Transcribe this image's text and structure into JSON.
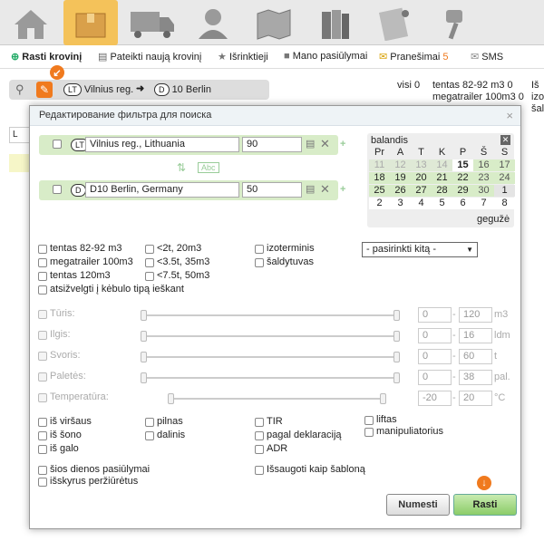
{
  "topnav": [
    "home-tab",
    "cargo-tab",
    "truck-tab",
    "person-tab",
    "map-tab",
    "books-tab",
    "paper-tab",
    "pin-tab"
  ],
  "subnav": {
    "find_cargo": "Rasti krovinį",
    "post_cargo": "Pateikti naują krovinį",
    "favorites": "Išrinktieji",
    "my_offers": "Mano pasiūlymai",
    "notifications": "Pranešimai",
    "notifications_count": "5",
    "sms": "SMS"
  },
  "route": {
    "from_code": "LT",
    "from": "Vilnius reg.",
    "to_code": "D",
    "to": "10 Berlin"
  },
  "bg_info": {
    "all": "visi 0",
    "line1": "tentas 82-92 m3 0",
    "line2": "megatrailer 100m3 0",
    "cut1": "Iš",
    "cut2": "izo",
    "cut3": "šal"
  },
  "bg_row": {
    "country": "L"
  },
  "dialog": {
    "title": "Редактирование фильтра для поиска",
    "close": "×",
    "from": {
      "country": "LT",
      "place": "Vilnius reg.,  Lithuania",
      "radius": "90"
    },
    "to": {
      "country": "D",
      "place": "D10 Berlin,  Germany",
      "radius": "50"
    },
    "swap_text": "Abc",
    "calendar": {
      "month": "balandis",
      "next_month": "gegužė",
      "weekdays": [
        "Pr",
        "A",
        "T",
        "K",
        "P",
        "Š",
        "S"
      ],
      "weeks": [
        [
          "11",
          "12",
          "13",
          "14",
          "15",
          "16",
          "17"
        ],
        [
          "18",
          "19",
          "20",
          "21",
          "22",
          "23",
          "24"
        ],
        [
          "25",
          "26",
          "27",
          "28",
          "29",
          "30",
          "1"
        ],
        [
          "2",
          "3",
          "4",
          "5",
          "6",
          "7",
          "8"
        ]
      ]
    },
    "body_types": [
      "tentas 82-92 m3",
      "megatrailer 100m3",
      "tentas 120m3",
      "<2t, 20m3",
      "<3.5t, 35m3",
      "<7.5t, 50m3",
      "izoterminis",
      "šaldytuvas"
    ],
    "body_type_select": "- pasirinkti kitą -",
    "consider_body": "atsižvelgti į kėbulo tipą ieškant",
    "ranges": [
      {
        "label": "Tūris:",
        "min": "0",
        "max": "120",
        "unit": "m3"
      },
      {
        "label": "Ilgis:",
        "min": "0",
        "max": "16",
        "unit": "ldm"
      },
      {
        "label": "Svoris:",
        "min": "0",
        "max": "60",
        "unit": "t"
      },
      {
        "label": "Paletės:",
        "min": "0",
        "max": "38",
        "unit": "pal."
      },
      {
        "label": "Temperatūra:",
        "min": "-20",
        "max": "20",
        "unit": "°C"
      }
    ],
    "loading": [
      "iš viršaus",
      "iš šono",
      "iš galo"
    ],
    "load_type": [
      "pilnas",
      "dalinis"
    ],
    "docs": [
      "TIR",
      "pagal deklaraciją",
      "ADR"
    ],
    "equipment": [
      "liftas",
      "manipuliatorius"
    ],
    "today_offers": "šios dienos pasiūlymai",
    "exclude_viewed": "išskyrus peržiūrėtus",
    "save_template": "Išsaugoti kaip šabloną",
    "cancel_btn": "Numesti",
    "search_btn": "Rasti",
    "arrow_glyph": "↓"
  }
}
